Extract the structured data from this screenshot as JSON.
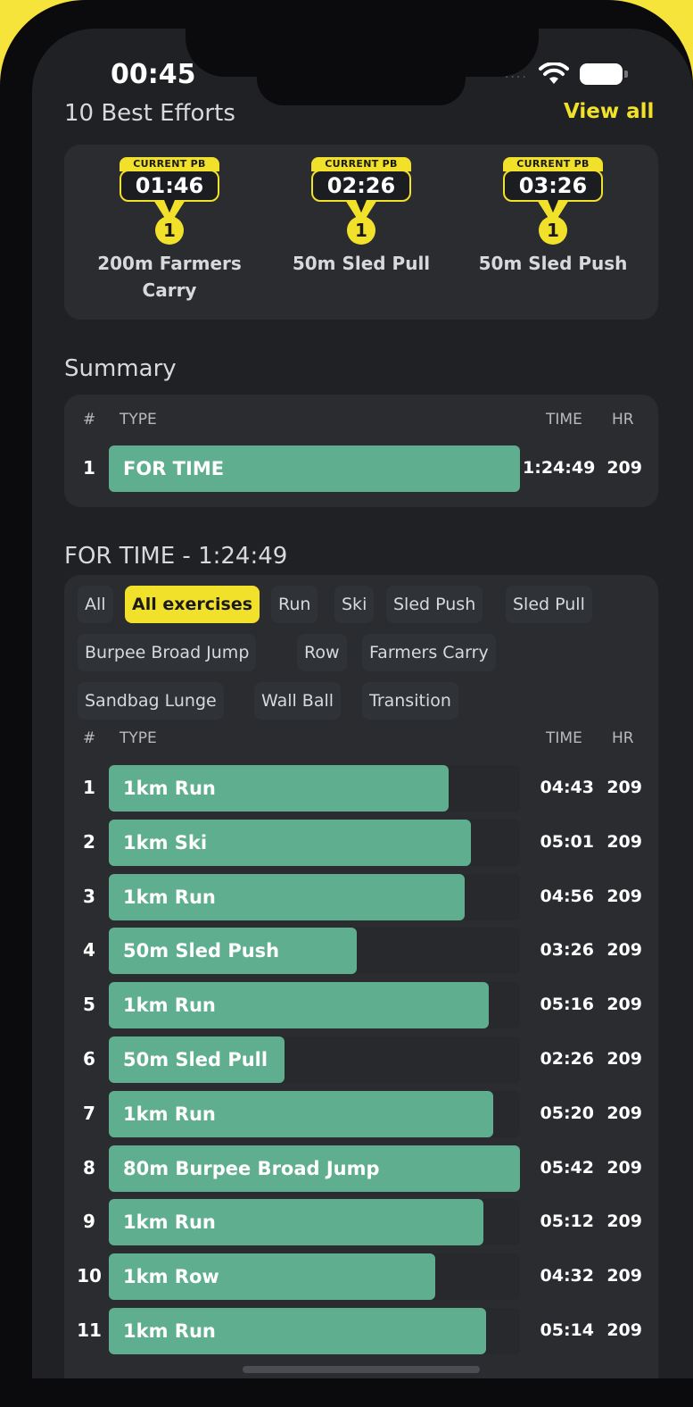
{
  "status_bar": {
    "time": "00:45",
    "dots": "....",
    "icons": [
      "wifi-icon",
      "battery-icon"
    ]
  },
  "best_efforts": {
    "title": "10 Best Efforts",
    "view_all": "View all",
    "items": [
      {
        "badge": "CURRENT PB",
        "time": "01:46",
        "rank": "1",
        "name_line1": "200m Farmers",
        "name_line2": "Carry"
      },
      {
        "badge": "CURRENT PB",
        "time": "02:26",
        "rank": "1",
        "name_line1": "50m Sled Pull",
        "name_line2": ""
      },
      {
        "badge": "CURRENT PB",
        "time": "03:26",
        "rank": "1",
        "name_line1": "50m Sled Push",
        "name_line2": ""
      }
    ]
  },
  "summary": {
    "title": "Summary",
    "headers": {
      "num": "#",
      "type": "TYPE",
      "time": "TIME",
      "hr": "HR"
    },
    "rows": [
      {
        "num": "1",
        "type": "FOR TIME",
        "time": "1:24:49",
        "hr": "209",
        "fill": 1.0
      }
    ]
  },
  "for_time": {
    "title": "FOR TIME - 1:24:49",
    "chips": [
      "All",
      "All exercises",
      "Run",
      "Ski",
      "Sled Push",
      "Sled Pull",
      "Burpee Broad Jump",
      "Row",
      "Farmers Carry",
      "Sandbag Lunge",
      "Wall Ball",
      "Transition"
    ],
    "active_chip": "All exercises",
    "headers": {
      "num": "#",
      "type": "TYPE",
      "time": "TIME",
      "hr": "HR"
    },
    "rows": [
      {
        "num": "1",
        "type": "1km Run",
        "time": "04:43",
        "hr": "209",
        "fill": 0.827
      },
      {
        "num": "2",
        "type": "1km Ski",
        "time": "05:01",
        "hr": "209",
        "fill": 0.88
      },
      {
        "num": "3",
        "type": "1km Run",
        "time": "04:56",
        "hr": "209",
        "fill": 0.865
      },
      {
        "num": "4",
        "type": "50m Sled Push",
        "time": "03:26",
        "hr": "209",
        "fill": 0.602
      },
      {
        "num": "5",
        "type": "1km Run",
        "time": "05:16",
        "hr": "209",
        "fill": 0.924
      },
      {
        "num": "6",
        "type": "50m Sled Pull",
        "time": "02:26",
        "hr": "209",
        "fill": 0.427
      },
      {
        "num": "7",
        "type": "1km Run",
        "time": "05:20",
        "hr": "209",
        "fill": 0.936
      },
      {
        "num": "8",
        "type": "80m Burpee Broad Jump",
        "time": "05:42",
        "hr": "209",
        "fill": 1.0
      },
      {
        "num": "9",
        "type": "1km Run",
        "time": "05:12",
        "hr": "209",
        "fill": 0.912
      },
      {
        "num": "10",
        "type": "1km Row",
        "time": "04:32",
        "hr": "209",
        "fill": 0.795
      },
      {
        "num": "11",
        "type": "1km Run",
        "time": "05:14",
        "hr": "209",
        "fill": 0.918
      }
    ]
  },
  "colors": {
    "accent": "#f2e12b",
    "bar": "#5fae90",
    "background": "#1f2124",
    "card": "#2a2c30"
  }
}
